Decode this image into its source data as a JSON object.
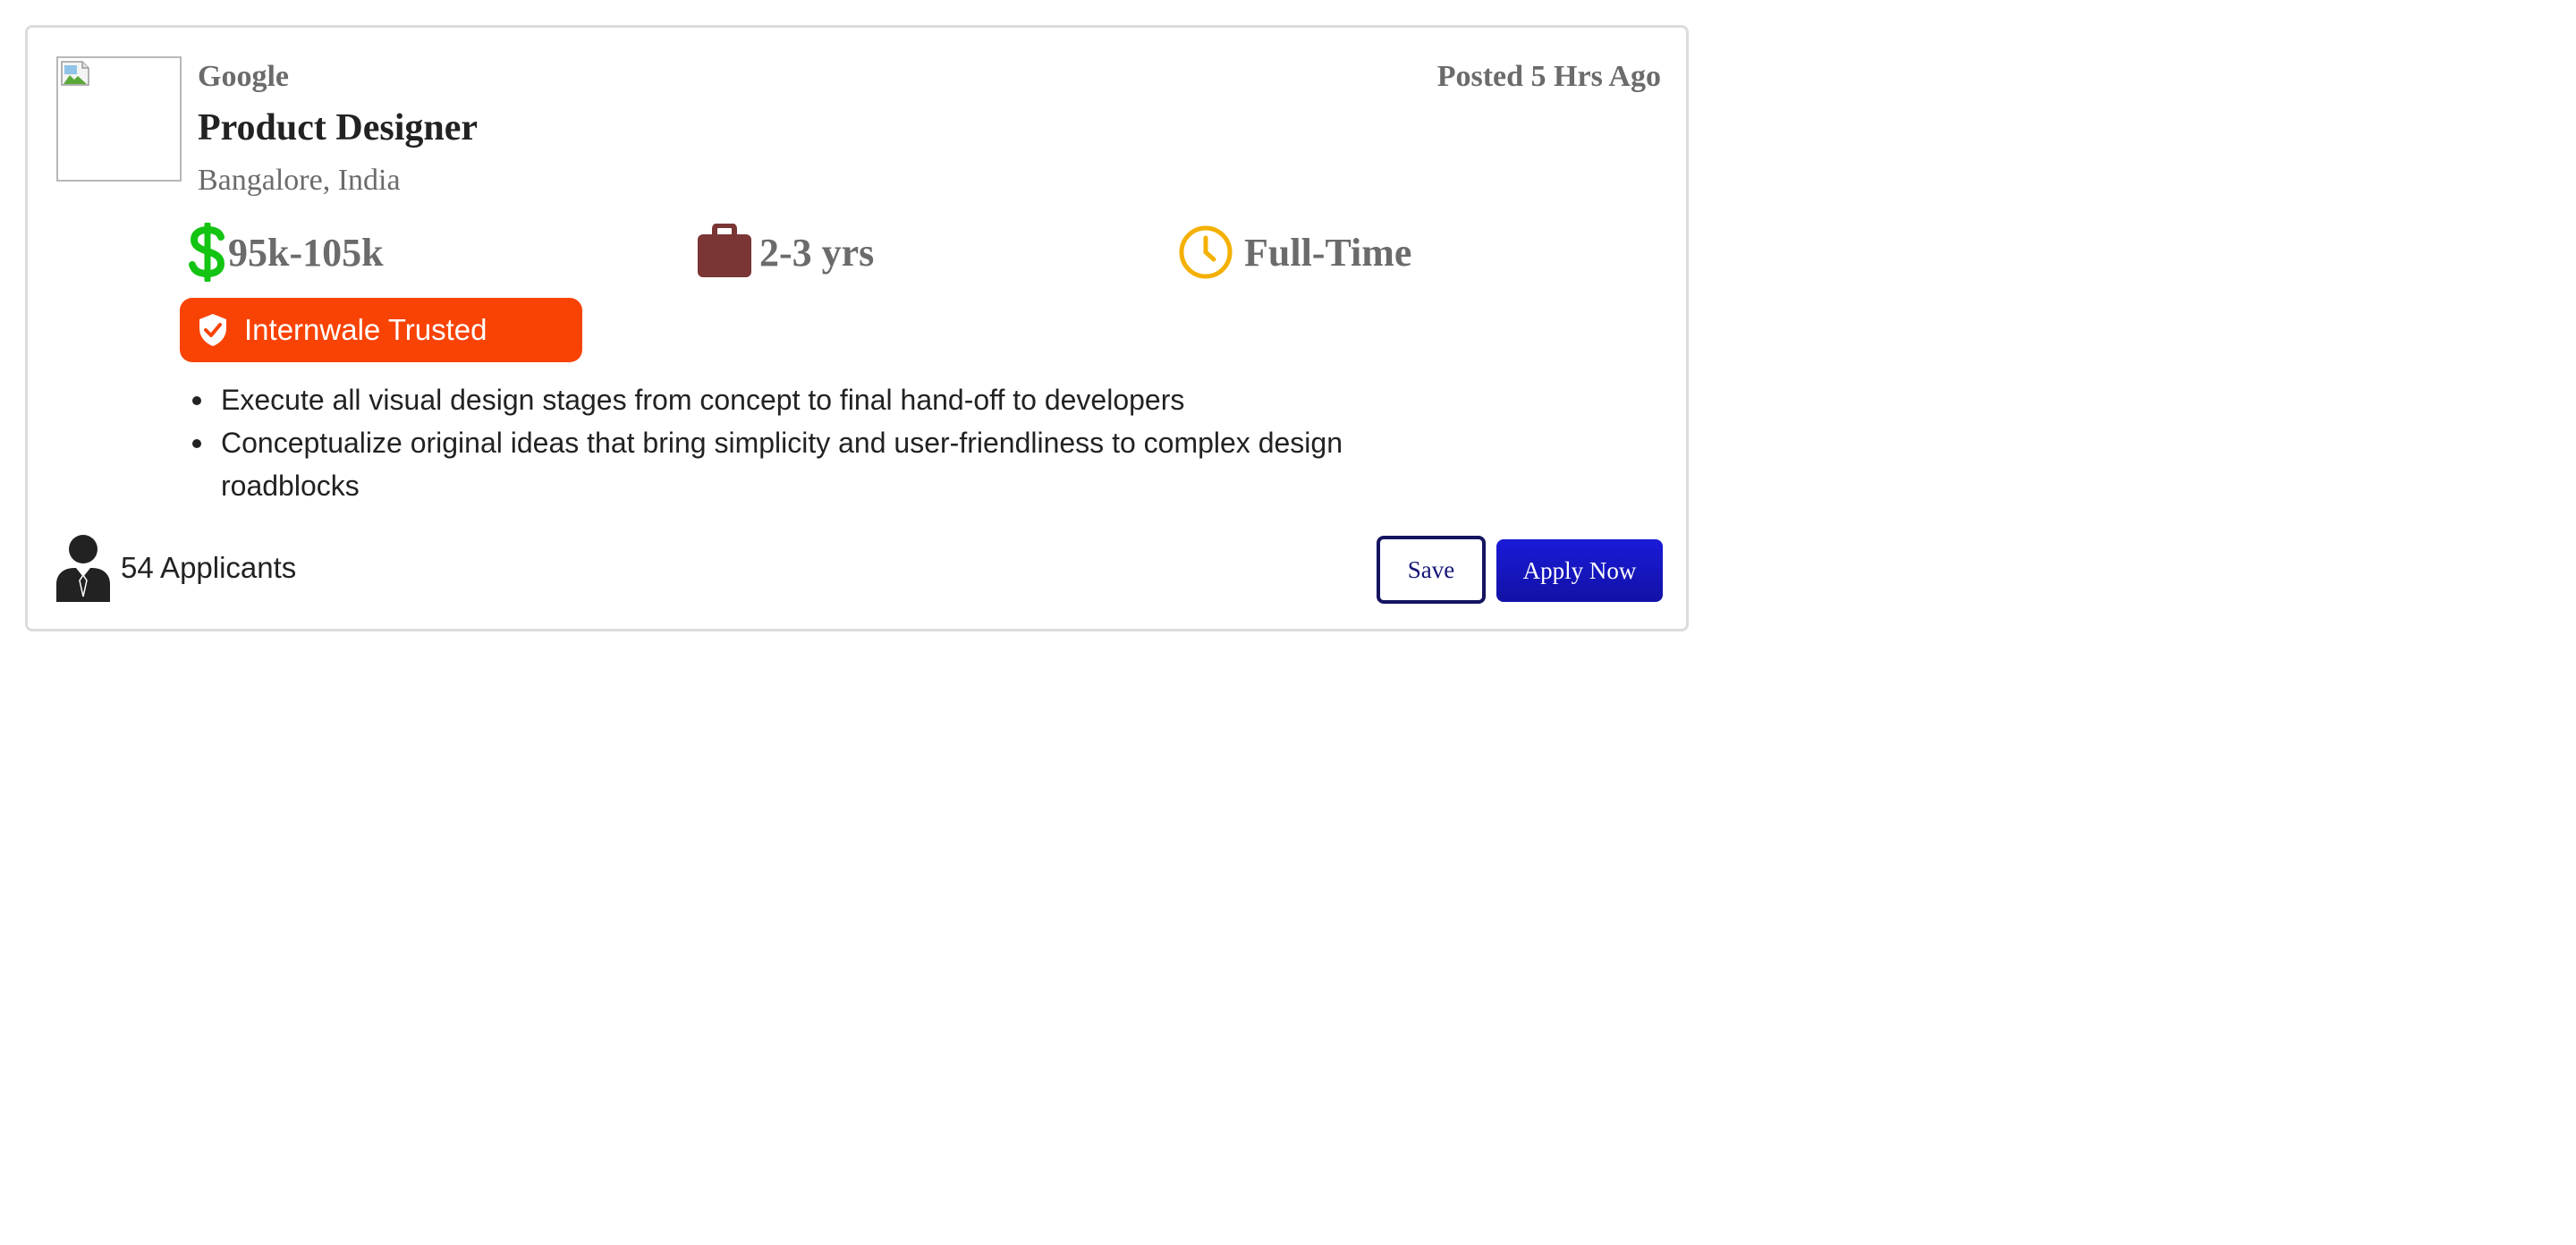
{
  "job": {
    "company": "Google",
    "title": "Product Designer",
    "location": "Bangalore, India",
    "posted": "Posted 5 Hrs Ago",
    "salary": "95k-105k",
    "experience": "2-3 yrs",
    "job_type": "Full-Time",
    "badge": "Internwale Trusted",
    "responsibilities": [
      "Execute all visual design stages from concept to final hand-off to developers",
      "Conceptualize original ideas that bring simplicity and user-friendliness to complex design roadblocks"
    ],
    "applicants": "54 Applicants",
    "save_label": "Save",
    "apply_label": "Apply Now"
  },
  "icons": {
    "salary": "dollar-icon",
    "experience": "briefcase-icon",
    "job_type": "clock-icon",
    "badge": "shield-check-icon",
    "applicants": "user-suit-icon",
    "logo": "broken-image-icon"
  },
  "colors": {
    "dollar": "#13c413",
    "briefcase": "#7a3535",
    "clock": "#f4b000",
    "badge_bg": "#f84305",
    "apply_bg": "#1515c4",
    "save_border": "#141460"
  }
}
